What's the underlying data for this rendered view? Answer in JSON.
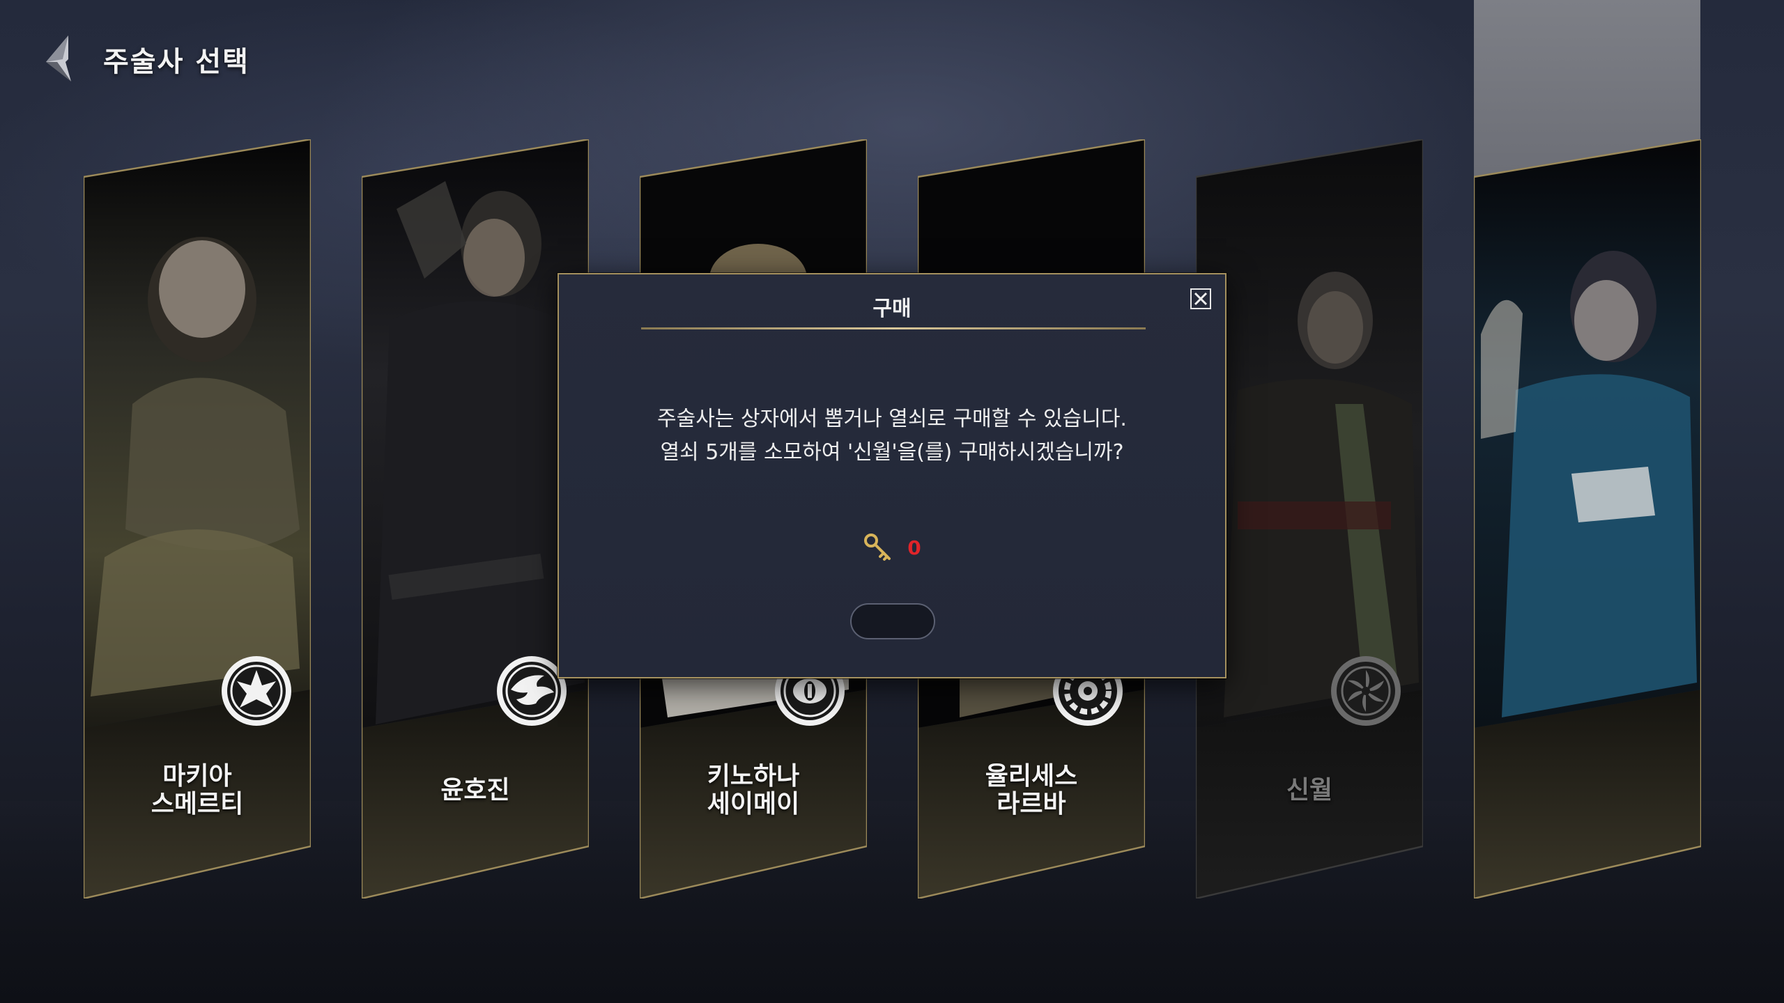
{
  "header": {
    "title": "주술사 선택",
    "back_icon": "back-arrow-icon"
  },
  "characters": [
    {
      "name": "마키아\n스메르티",
      "emblem": "ornate-crest-icon",
      "locked": false
    },
    {
      "name": "윤호진",
      "emblem": "bird-swirl-icon",
      "locked": false
    },
    {
      "name": "키노하나\n세이메이",
      "emblem": "eye-icon",
      "locked": false
    },
    {
      "name": "율리세스\n라르바",
      "emblem": "gear-sun-icon",
      "locked": false
    },
    {
      "name": "신월",
      "emblem": "spiral-wheel-icon",
      "locked": true
    },
    {
      "name": "",
      "emblem": "",
      "locked": false
    }
  ],
  "dialog": {
    "title": "구매",
    "message": "주술사는 상자에서 뽑거나 열쇠로 구매할 수 있습니다.\n열쇠 5개를 소모하여 '신월'을(를) 구매하시겠습니까?",
    "key_count": "0",
    "key_icon": "golden-key-icon",
    "close_icon": "close-icon",
    "confirm_label": ""
  },
  "colors": {
    "accent_gold": "#a5915e",
    "key_count_red": "#e0242a",
    "dialog_bg": "#252a3a"
  }
}
